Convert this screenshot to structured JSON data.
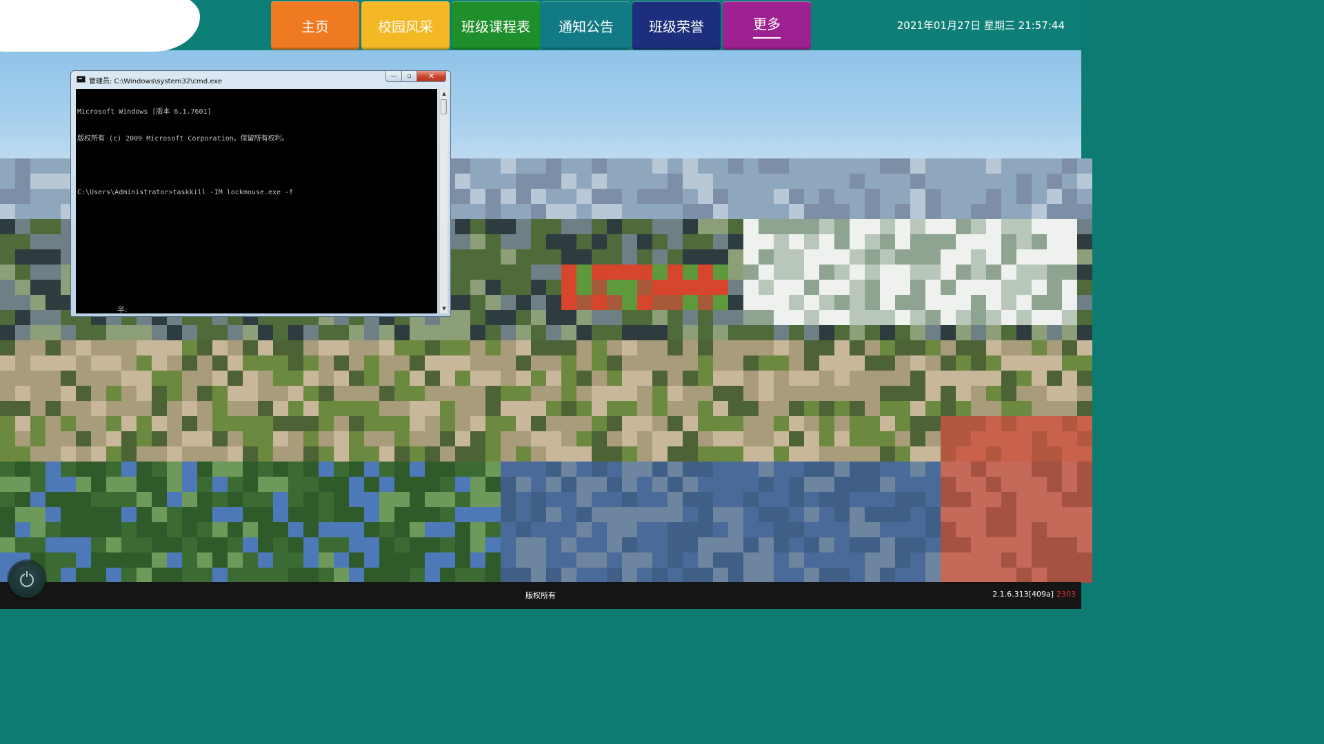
{
  "nav": {
    "items": [
      {
        "label": "主页",
        "color": "#f07a22"
      },
      {
        "label": "校园风采",
        "color": "#f3b824"
      },
      {
        "label": "班级课程表",
        "color": "#1e8f2a"
      },
      {
        "label": "通知公告",
        "color": "#127a85"
      },
      {
        "label": "班级荣誉",
        "color": "#1d2f7c"
      },
      {
        "label": "更多",
        "color": "#9d2190",
        "active": true
      }
    ]
  },
  "header": {
    "datetime": "2021年01月27日 星期三 21:57:44"
  },
  "cmd_window": {
    "title": "管理员: C:\\Windows\\system32\\cmd.exe",
    "buttons": {
      "minimize": "—",
      "maximize": "▫",
      "close": "✕"
    },
    "lines": [
      "Microsoft Windows [版本 6.1.7601]",
      "版权所有 (c) 2009 Microsoft Corporation。保留所有权利。",
      "",
      "C:\\Users\\Administrator>taskkill -IM lockmouse.exe -f"
    ],
    "ime_status": "半:"
  },
  "footer": {
    "copyright": "版权所有",
    "version": "2.1.6.313[409a]",
    "version_code": "2303"
  },
  "icons": {
    "power": "power-icon",
    "cmd": "cmd-icon"
  }
}
